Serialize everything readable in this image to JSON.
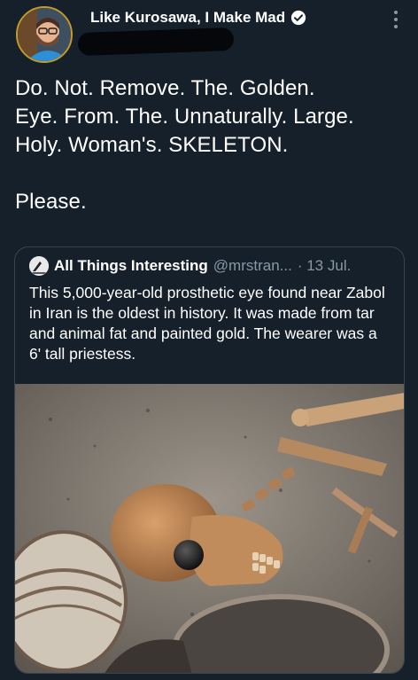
{
  "tweet": {
    "author_name": "Like Kurosawa, I Make Mad",
    "text": "Do. Not. Remove. The. Golden.\nEye. From. The. Unnaturally. Large.\nHoly. Woman's. SKELETON.\n\nPlease."
  },
  "quoted": {
    "author_name": "All Things Interesting",
    "handle": "@mrstran...",
    "date": "· 13 Jul.",
    "text": "This 5,000-year-old prosthetic eye found near Zabol in Iran is the oldest in history. It was made from tar and animal fat and painted gold. The wearer was a 6' tall priestess."
  },
  "colors": {
    "background": "#15202b",
    "border": "#38444d",
    "secondary_text": "#8899a6",
    "verified": "#ffffff"
  },
  "icons": [
    "avatar",
    "verified-badge-icon",
    "more-options-icon",
    "quoted-avatar"
  ]
}
